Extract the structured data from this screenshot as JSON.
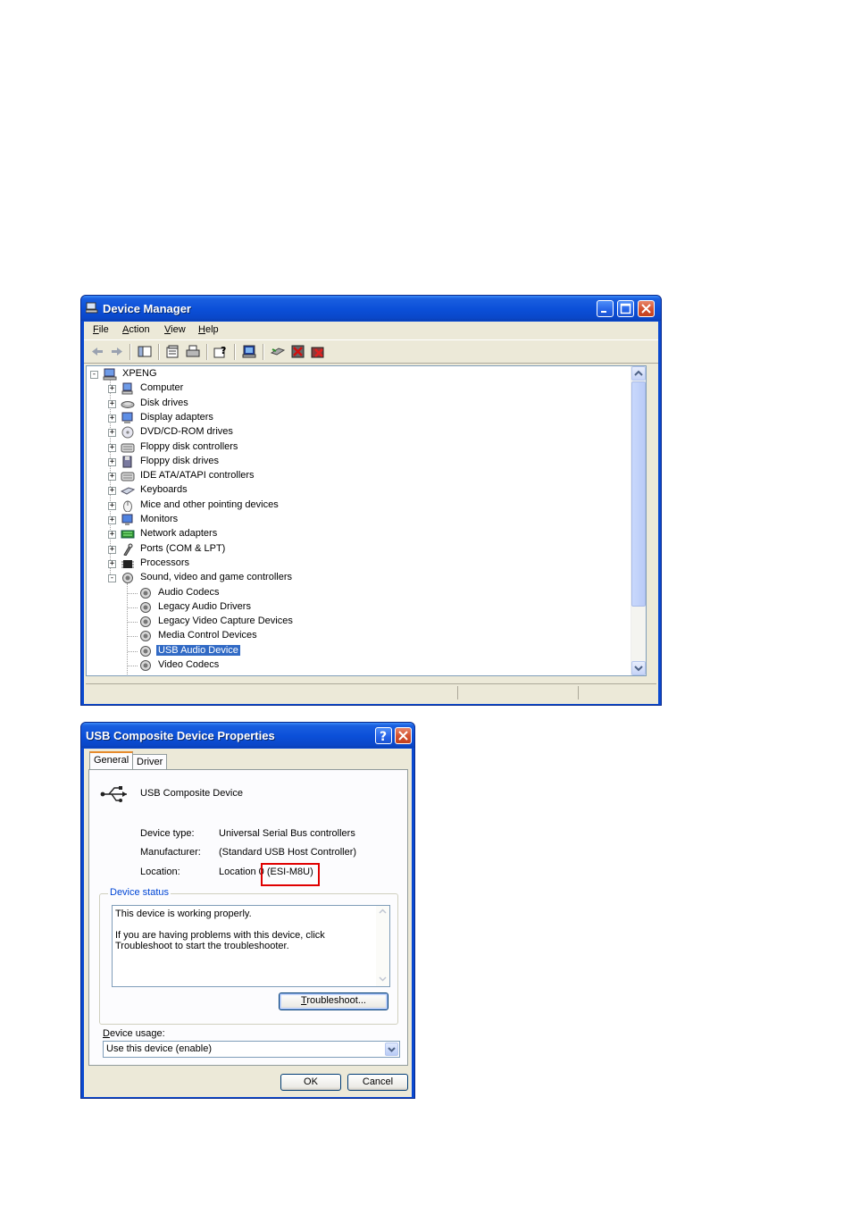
{
  "device_manager": {
    "title": "Device Manager",
    "menu": {
      "file": {
        "u": "F",
        "rest": "ile"
      },
      "action": {
        "u": "A",
        "rest": "ction"
      },
      "view": {
        "u": "V",
        "rest": "iew"
      },
      "help": {
        "u": "H",
        "rest": "elp"
      }
    },
    "toolbar_icons": [
      "back-icon",
      "forward-icon",
      "show-hide-console-tree-icon",
      "properties-icon",
      "print-icon",
      "help-icon",
      "scan-hardware-icon",
      "update-driver-icon",
      "disable-device-icon",
      "uninstall-device-icon"
    ],
    "tree": {
      "root": "XPENG",
      "categories": [
        {
          "label": "Computer",
          "icon": "computer-icon"
        },
        {
          "label": "Disk drives",
          "icon": "disk-drive-icon"
        },
        {
          "label": "Display adapters",
          "icon": "display-adapter-icon"
        },
        {
          "label": "DVD/CD-ROM drives",
          "icon": "cdrom-icon"
        },
        {
          "label": "Floppy disk controllers",
          "icon": "controller-icon"
        },
        {
          "label": "Floppy disk drives",
          "icon": "floppy-icon"
        },
        {
          "label": "IDE ATA/ATAPI controllers",
          "icon": "controller-icon"
        },
        {
          "label": "Keyboards",
          "icon": "keyboard-icon"
        },
        {
          "label": "Mice and other pointing devices",
          "icon": "mouse-icon"
        },
        {
          "label": "Monitors",
          "icon": "monitor-icon"
        },
        {
          "label": "Network adapters",
          "icon": "network-adapter-icon"
        },
        {
          "label": "Ports (COM & LPT)",
          "icon": "port-icon"
        },
        {
          "label": "Processors",
          "icon": "processor-icon"
        },
        {
          "label": "Sound, video and game controllers",
          "icon": "speaker-icon"
        }
      ],
      "sound_children": [
        "Audio Codecs",
        "Legacy Audio Drivers",
        "Legacy Video Capture Devices",
        "Media Control Devices",
        "USB Audio Device",
        "Video Codecs"
      ],
      "selected": "USB Audio Device"
    }
  },
  "properties": {
    "title": "USB Composite Device Properties",
    "tabs": [
      "General",
      "Driver"
    ],
    "active_tab": "General",
    "device_name": "USB Composite Device",
    "fields": [
      {
        "label": "Device type:",
        "value": "Universal Serial Bus controllers"
      },
      {
        "label": "Manufacturer:",
        "value": "(Standard USB Host Controller)"
      },
      {
        "label": "Location:",
        "value": "Location 0 (ESI-M8U)"
      }
    ],
    "device_status_label": "Device status",
    "status_message_1": "This device is working properly.",
    "status_message_2": "If you are having problems with this device, click Troubleshoot to start the troubleshooter.",
    "troubleshoot_button": {
      "u": "T",
      "rest": "roubleshoot..."
    },
    "device_usage_label": {
      "u": "D",
      "rest": "evice usage:"
    },
    "device_usage_value": "Use this device (enable)",
    "ok_label": "OK",
    "cancel_label": "Cancel",
    "highlight_color": "#e00000"
  }
}
